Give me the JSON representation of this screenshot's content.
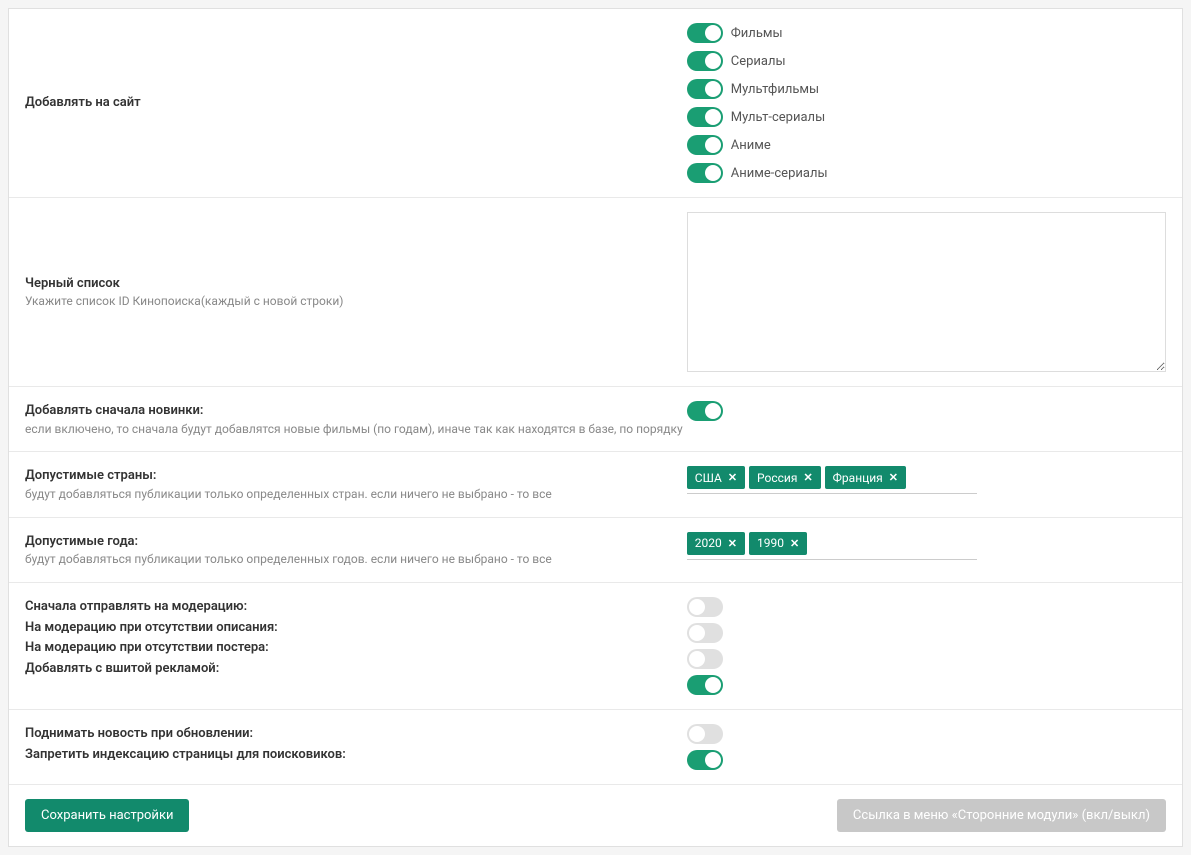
{
  "addToSite": {
    "label": "Добавлять на сайт",
    "items": [
      {
        "name": "films",
        "label": "Фильмы",
        "on": true
      },
      {
        "name": "series",
        "label": "Сериалы",
        "on": true
      },
      {
        "name": "cartoons",
        "label": "Мультфильмы",
        "on": true
      },
      {
        "name": "cartoon-series",
        "label": "Мульт-сериалы",
        "on": true
      },
      {
        "name": "anime",
        "label": "Аниме",
        "on": true
      },
      {
        "name": "anime-series",
        "label": "Аниме-сериалы",
        "on": true
      }
    ]
  },
  "blacklist": {
    "label": "Черный список",
    "sub": "Укажите список ID Кинопоиска(каждый с новой строки)",
    "value": ""
  },
  "newFirst": {
    "label": "Добавлять сначала новинки:",
    "sub": "если включено, то сначала будут добавлятся новые фильмы (по годам), иначе так как находятся в базе, по порядку",
    "on": true
  },
  "countries": {
    "label": "Допустимые страны:",
    "sub": "будут добавляться публикации только определенных стран. если ничего не выбрано - то все",
    "tags": [
      "США",
      "Россия",
      "Франция"
    ]
  },
  "years": {
    "label": "Допустимые года:",
    "sub": "будут добавляться публикации только определенных годов. если ничего не выбрано - то все",
    "tags": [
      "2020",
      "1990"
    ]
  },
  "moderation": {
    "lines": [
      {
        "name": "moderation-first",
        "label": "Сначала отправлять на модерацию:",
        "on": false
      },
      {
        "name": "moderation-no-desc",
        "label": "На модерацию при отсутствии описания:",
        "on": false
      },
      {
        "name": "moderation-no-poster",
        "label": "На модерацию при отсутствии постера:",
        "on": false
      },
      {
        "name": "embedded-ads",
        "label": "Добавлять с вшитой рекламой:",
        "on": true
      }
    ]
  },
  "updates": {
    "lines": [
      {
        "name": "bump-on-update",
        "label": "Поднимать новость при обновлении:",
        "on": false
      },
      {
        "name": "noindex",
        "label": "Запретить индексацию страницы для поисковиков:",
        "on": true
      }
    ]
  },
  "footer": {
    "save": "Сохранить настройки",
    "menuLink": "Ссылка в меню «Сторонние модули» (вкл/выкл)"
  }
}
